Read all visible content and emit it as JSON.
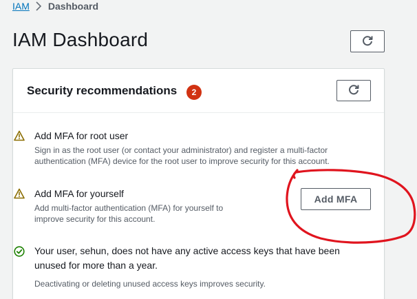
{
  "breadcrumb": {
    "root": "IAM",
    "current": "Dashboard"
  },
  "page": {
    "title": "IAM Dashboard"
  },
  "security": {
    "title": "Security recommendations",
    "count": "2",
    "recommendations": [
      {
        "status": "warning",
        "title": "Add MFA for root user",
        "description": "Sign in as the root user (or contact your administrator) and register a multi-factor authentication (MFA) device for the root user to improve security for this account."
      },
      {
        "status": "warning",
        "title": "Add MFA for yourself",
        "description": "Add multi-factor authentication (MFA) for yourself to improve security for this account.",
        "action_label": "Add MFA"
      },
      {
        "status": "success",
        "title": "Your user, sehun, does not have any active access keys that have been unused for more than a year.",
        "description": "Deactivating or deleting unused access keys improves security."
      }
    ]
  },
  "icons": {
    "refresh": "refresh-icon",
    "warning": "warning-icon",
    "success": "check-circle-icon",
    "separator": "chevron-right-icon"
  },
  "colors": {
    "link": "#0073bb",
    "badge": "#d13212",
    "warning": "#8a6d00",
    "success": "#1d8102",
    "annotation": "#e0141e"
  }
}
